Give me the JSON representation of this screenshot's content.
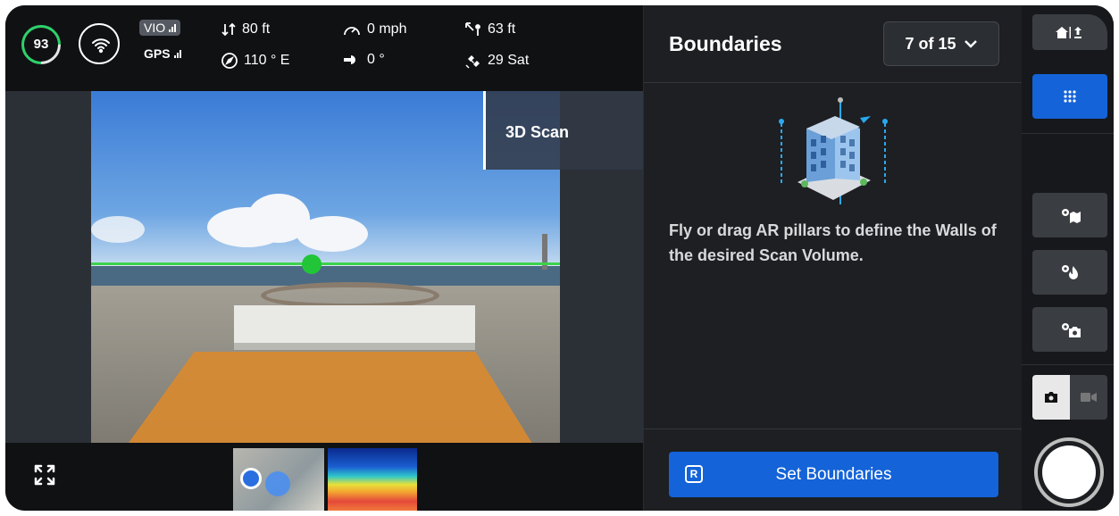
{
  "status": {
    "battery": "93",
    "vio_label": "VIO",
    "gps_label": "GPS",
    "altitude": "80 ft",
    "heading": "110 ° E",
    "speed": "0 mph",
    "gimbal": "0 °",
    "distance": "63 ft",
    "satellites": "29 Sat"
  },
  "camera": {
    "mode_tag": "3D Scan"
  },
  "panel": {
    "title": "Boundaries",
    "step": "7 of 15",
    "instructions": "Fly or drag AR pillars to define the Walls of the desired Scan Volume.",
    "button_key": "R",
    "button_label": "Set Boundaries"
  },
  "rail": {
    "home_icon": "home-upload-icon",
    "grid_icon": "grid-icon",
    "tools": [
      "map-gear-icon",
      "fire-gear-icon",
      "camera-gear-icon"
    ],
    "capture_modes": [
      "photo",
      "video"
    ],
    "active_mode": "photo"
  },
  "colors": {
    "accent": "#1463d8",
    "battery_ok": "#2fd06b",
    "horizon": "#3bd24c"
  }
}
